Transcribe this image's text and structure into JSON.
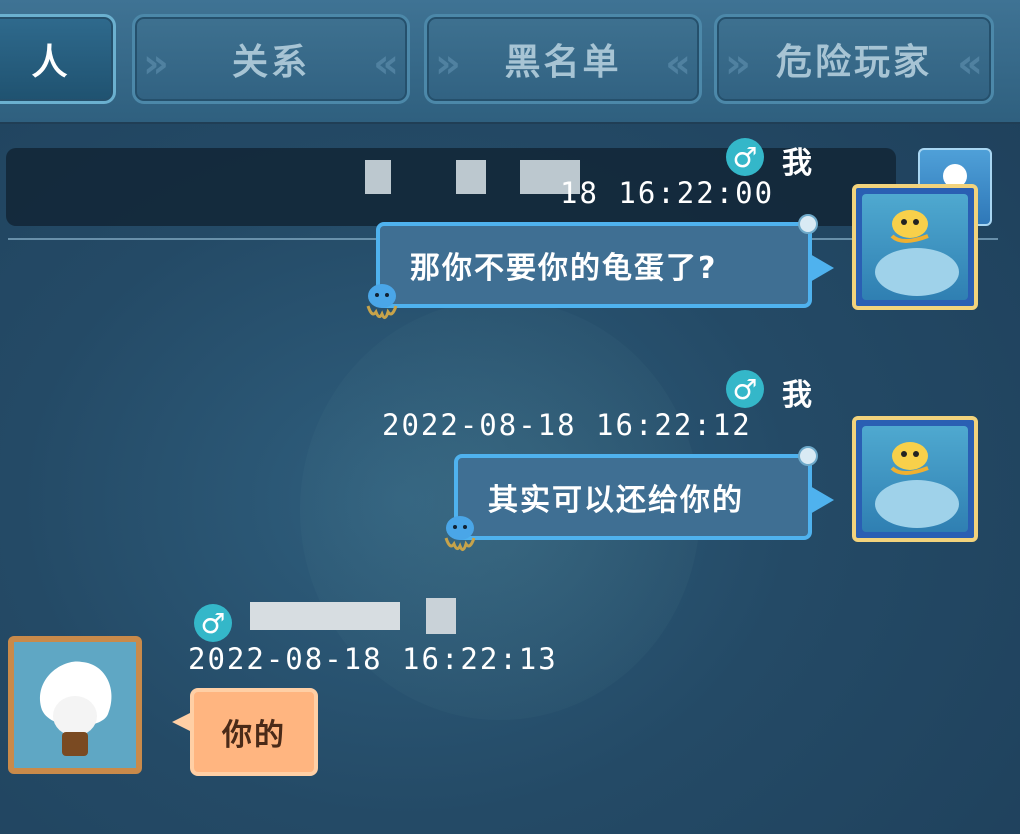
{
  "tabs": [
    {
      "label": "人",
      "active": true
    },
    {
      "label": "关系",
      "active": false
    },
    {
      "label": "黑名单",
      "active": false
    },
    {
      "label": "危险玩家",
      "active": false
    }
  ],
  "messages": [
    {
      "sender": "我",
      "gender": "♂",
      "timestamp_visible": "18   16:22:00",
      "text": "那你不要你的龟蛋了?",
      "side": "right"
    },
    {
      "sender": "我",
      "gender": "♂",
      "timestamp_visible": "2022-08-18   16:22:12",
      "text": "其实可以还给你的",
      "side": "right"
    },
    {
      "sender": "",
      "gender": "♂",
      "timestamp_visible": "2022-08-18   16:22:13",
      "text": "你的",
      "side": "left"
    }
  ],
  "icons": {
    "profile": "user-icon",
    "gender": "male-icon",
    "sticker": "octopus-icon"
  },
  "colors": {
    "my_bubble_border": "#4fb2ee",
    "other_bubble_fill": "#ffb580",
    "gender_badge": "#34b7c9"
  }
}
